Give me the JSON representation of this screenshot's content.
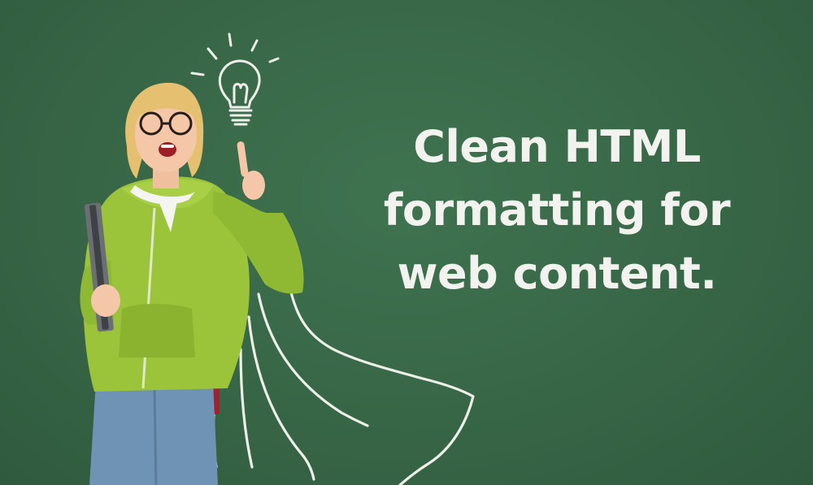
{
  "headline": {
    "line1": "Clean HTML",
    "line2": "formatting for",
    "line3": "web content."
  },
  "colors": {
    "background": "#376646",
    "text": "#f2f2ee",
    "chalk": "#eef0ea",
    "hoodie": "#9bc43a",
    "backpack": "#c8283a",
    "jeans": "#6f93b5",
    "hair": "#e4c070"
  },
  "icons": {
    "idea": "lightbulb-icon",
    "cape": "chalk-cape-drawing"
  }
}
